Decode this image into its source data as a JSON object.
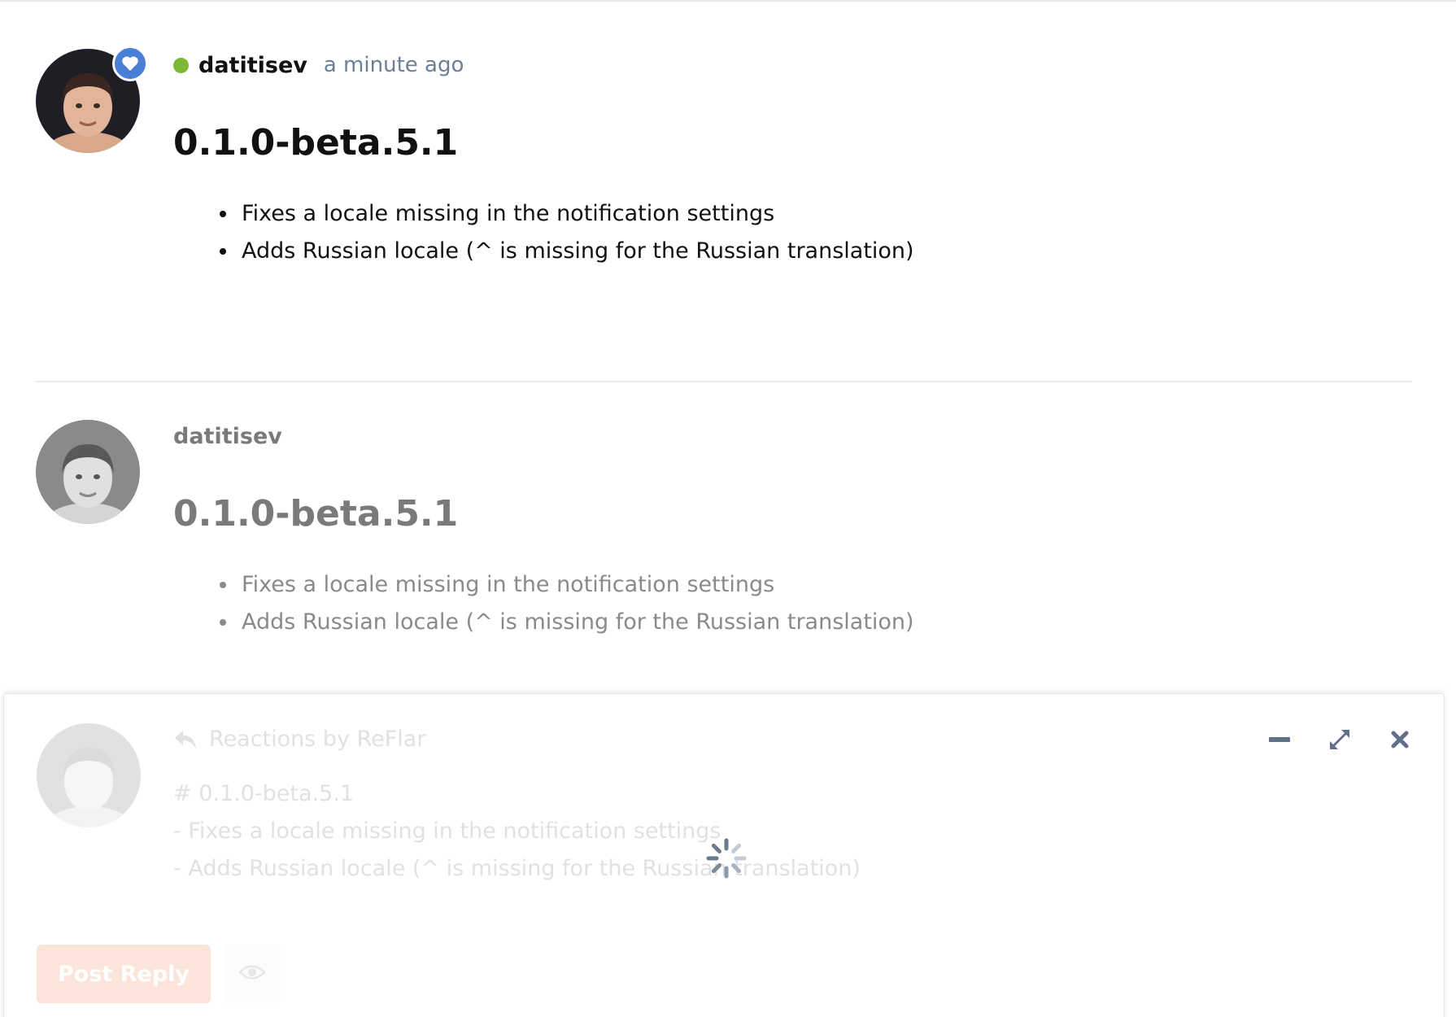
{
  "posts": [
    {
      "username": "datitisev",
      "time": "a minute ago",
      "online": true,
      "title": "0.1.0-beta.5.1",
      "items": [
        "Fixes a locale missing in the notification settings",
        "Adds Russian locale (^ is missing for the Russian translation)"
      ]
    },
    {
      "username": "datitisev",
      "title": "0.1.0-beta.5.1",
      "items": [
        "Fixes a locale missing in the notification settings",
        "Adds Russian locale (^ is missing for the Russian translation)"
      ]
    }
  ],
  "composer": {
    "reply_to": "Reactions by ReFlar",
    "lines": [
      "# 0.1.0-beta.5.1",
      "- Fixes a locale missing in the notification settings",
      "- Adds Russian locale (^ is missing for the Russian translation)"
    ],
    "submit_label": "Post Reply",
    "icons": {
      "minimize": "minimize-icon",
      "fullscreen": "fullscreen-icon",
      "close": "close-icon",
      "preview": "eye-icon",
      "reply": "reply-icon",
      "loading": "loading-spinner"
    }
  },
  "colors": {
    "online": "#7cb936",
    "badge": "#4a7fd8",
    "time": "#6a7f99",
    "primary_button": "#e7672e",
    "controls": "#5f7088"
  }
}
